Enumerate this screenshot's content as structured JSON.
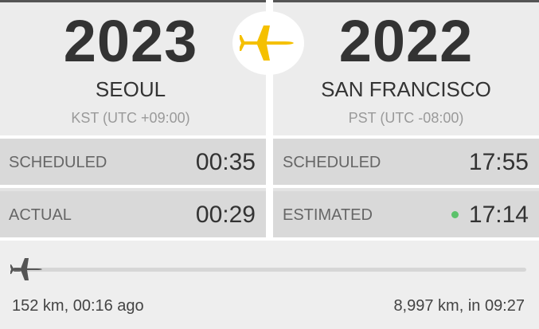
{
  "origin": {
    "code": "2023",
    "city": "SEOUL",
    "timezone": "KST (UTC +09:00)"
  },
  "destination": {
    "code": "2022",
    "city": "SAN FRANCISCO",
    "timezone": "PST (UTC -08:00)"
  },
  "times": {
    "origin_scheduled_label": "SCHEDULED",
    "origin_scheduled": "00:35",
    "origin_actual_label": "ACTUAL",
    "origin_actual": "00:29",
    "dest_scheduled_label": "SCHEDULED",
    "dest_scheduled": "17:55",
    "dest_estimated_label": "ESTIMATED",
    "dest_estimated": "17:14"
  },
  "progress": {
    "fraction": 0.017,
    "elapsed_text": "152 km, 00:16 ago",
    "remaining_text": "8,997 km, in 09:27"
  },
  "icons": {
    "center": "plane-icon",
    "progress": "plane-icon"
  },
  "colors": {
    "plane_accent": "#f5c000",
    "estimated_dot": "#5cc26b"
  }
}
